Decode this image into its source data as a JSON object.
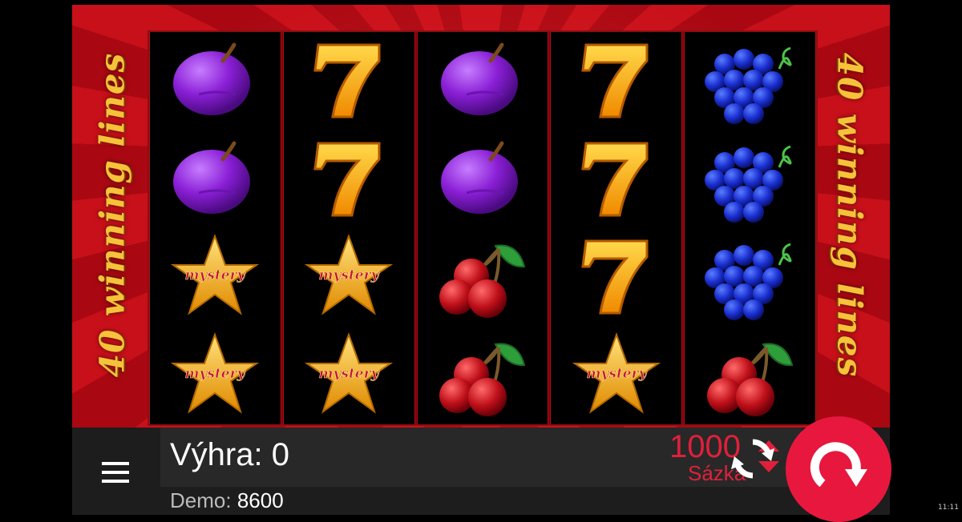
{
  "side_text": {
    "left": "40 winning lines",
    "right": "40 winning lines"
  },
  "reels": [
    [
      "plum",
      "plum",
      "mystery-star",
      "mystery-star"
    ],
    [
      "seven",
      "seven",
      "mystery-star",
      "mystery-star"
    ],
    [
      "plum",
      "plum",
      "cherries",
      "cherries"
    ],
    [
      "seven",
      "seven",
      "seven",
      "mystery-star"
    ],
    [
      "grapes",
      "grapes",
      "grapes",
      "cherries"
    ]
  ],
  "mystery_label": "mystery",
  "bottom_bar": {
    "win_label": "Výhra: 0",
    "demo_label": "Demo:",
    "demo_value": "8600",
    "bet_value": "1000",
    "bet_label": "Sázka"
  },
  "icons": {
    "menu": "hamburger-menu-icon",
    "autoplay": "refresh-icon",
    "spin": "spin-arrow-icon",
    "bet_up": "triangle-up-icon",
    "bet_down": "triangle-down-icon"
  },
  "colors": {
    "accent": "#e8173e",
    "bet_text": "#e0203a",
    "frame_red": "#c8101a",
    "side_text": "#f6c23a"
  },
  "status_bar": {
    "time": "11:11"
  }
}
